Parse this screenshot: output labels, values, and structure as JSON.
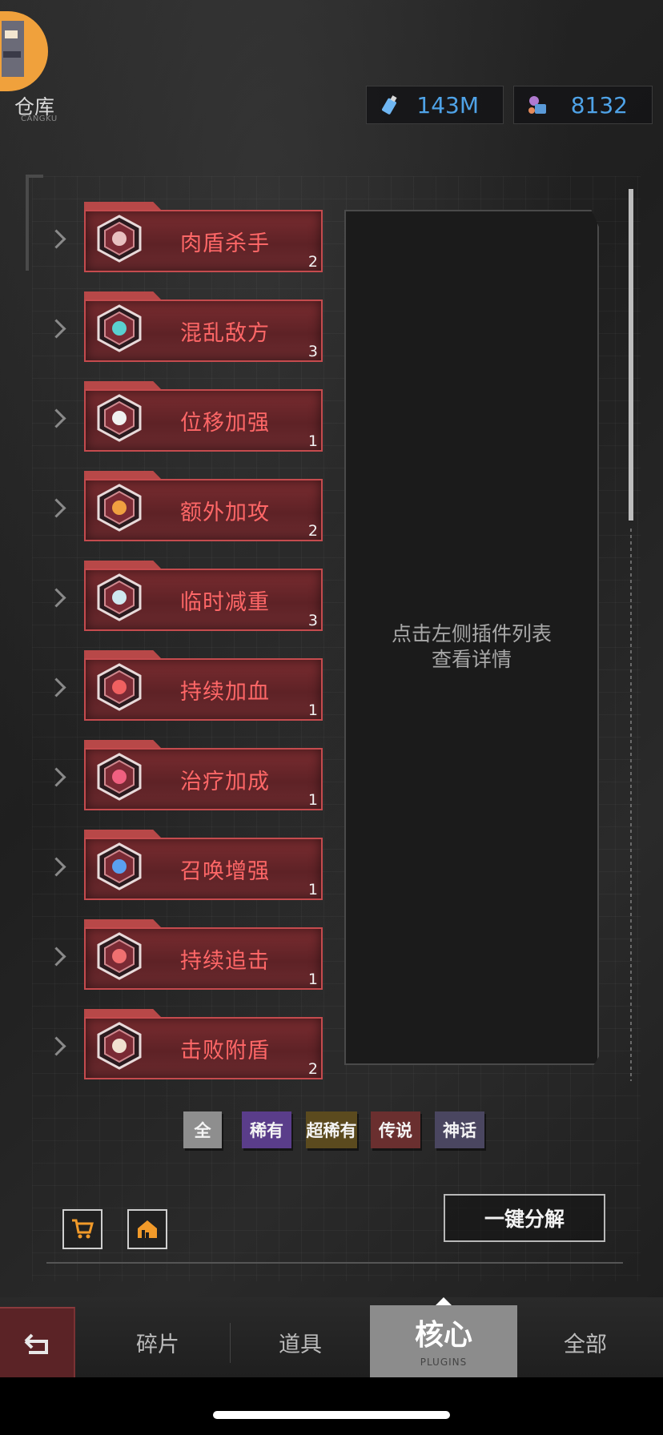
{
  "header": {
    "warehouse_label": "仓库",
    "warehouse_sub": "CANGKU",
    "resources": [
      {
        "icon": "potion-bottle-icon",
        "value": "143M"
      },
      {
        "icon": "robot-gear-icon",
        "value": "8132"
      }
    ]
  },
  "plugins": [
    {
      "name": "肉盾杀手",
      "count": "2"
    },
    {
      "name": "混乱敌方",
      "count": "3"
    },
    {
      "name": "位移加强",
      "count": "1"
    },
    {
      "name": "额外加攻",
      "count": "2"
    },
    {
      "name": "临时减重",
      "count": "3"
    },
    {
      "name": "持续加血",
      "count": "1"
    },
    {
      "name": "治疗加成",
      "count": "1"
    },
    {
      "name": "召唤增强",
      "count": "1"
    },
    {
      "name": "持续追击",
      "count": "1"
    },
    {
      "name": "击败附盾",
      "count": "2"
    }
  ],
  "detail": {
    "hint_line1": "点击左侧插件列表",
    "hint_line2": "查看详情"
  },
  "filters": [
    {
      "label": "全",
      "color": "#8e8e8e"
    },
    {
      "label": "稀有",
      "color": "#5a3d8a"
    },
    {
      "label": "超稀有",
      "color": "#5b4a1e"
    },
    {
      "label": "传说",
      "color": "#6a2f2f"
    },
    {
      "label": "神话",
      "color": "#4a4660"
    }
  ],
  "actions": {
    "decompose_label": "一键分解",
    "shop_icon": "cart-icon",
    "home_icon": "house-icon"
  },
  "nav": {
    "tabs": [
      "碎片",
      "道具",
      "核心",
      "全部"
    ],
    "active_sub": "PLUGINS",
    "back_icon": "return-arrow-icon"
  }
}
